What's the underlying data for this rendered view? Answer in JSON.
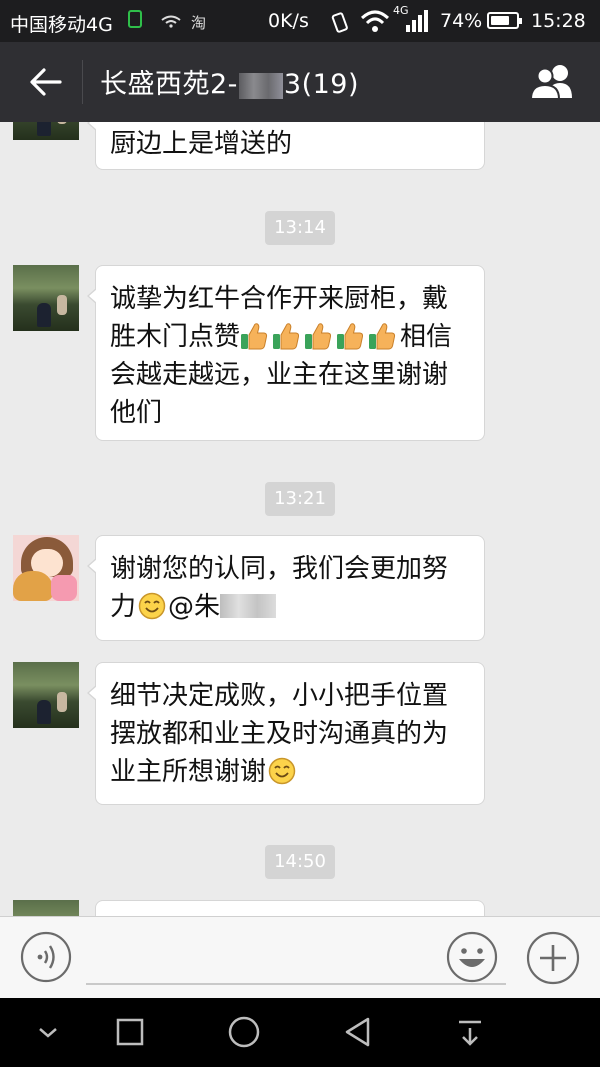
{
  "status_bar": {
    "carrier": "中国移动4G",
    "taobao": "淘",
    "speed": "0K/s",
    "network": "4G",
    "battery": "74%",
    "battery_level": 0.74,
    "time": "15:28"
  },
  "title_bar": {
    "title_prefix": "长盛西苑2-",
    "title_suffix": "3(19)"
  },
  "messages": [
    {
      "type": "text",
      "avatar": "field-photo",
      "text": "厨边上是增送的"
    },
    {
      "type": "time",
      "text": "13:14"
    },
    {
      "type": "text",
      "avatar": "field-photo",
      "line1": "诚挚为红牛合作开来厨柜，戴",
      "line2_pre": "胜木门点赞",
      "thumb_count": 5,
      "line2_post": "相信",
      "line3": "会越走越远，业主在这里谢谢",
      "line4": "他们"
    },
    {
      "type": "time",
      "text": "13:21"
    },
    {
      "type": "text",
      "avatar": "girl-cartoon",
      "line1": "谢谢您的认同，我们会更加努",
      "line2_pre": "力",
      "line2_post": "@朱"
    },
    {
      "type": "text",
      "avatar": "field-photo",
      "line1": "细节决定成败，小小把手位置",
      "line2": "摆放都和业主及时沟通真的为",
      "line3": "业主所想谢谢"
    },
    {
      "type": "time",
      "text": "14:50"
    }
  ],
  "icons": {
    "back": "arrow-left-icon",
    "group": "people-icon",
    "voice": "voice-icon",
    "emoji": "smiley-icon",
    "more": "plus-icon"
  },
  "colors": {
    "titlebar": "#2f2f33",
    "statusbar": "#1d1d1f",
    "chat_bg": "#ebebeb",
    "timestamp_bg": "#d4d4d4"
  }
}
